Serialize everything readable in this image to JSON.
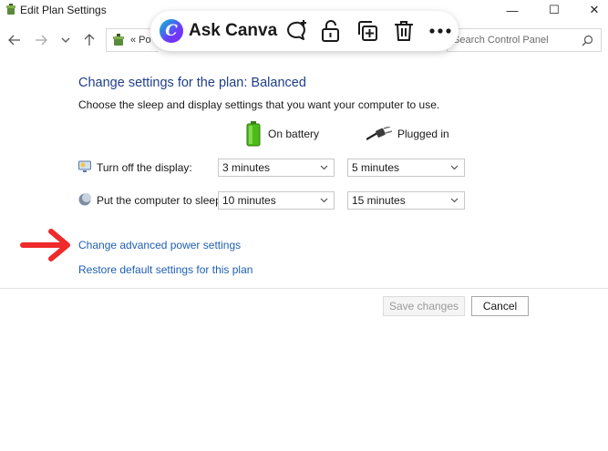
{
  "window": {
    "title": "Edit Plan Settings",
    "minimize_glyph": "—",
    "maximize_glyph": "☐",
    "close_glyph": "✕"
  },
  "navbar": {
    "address_text": "« Po",
    "search_placeholder": "Search Control Panel"
  },
  "canva_toolbar": {
    "logo_letter": "C",
    "label": "Ask Canva",
    "tools": [
      "comment-add-icon",
      "unlock-icon",
      "duplicate-icon",
      "trash-icon",
      "more-icon"
    ]
  },
  "plan": {
    "heading": "Change settings for the plan: Balanced",
    "subtitle": "Choose the sleep and display settings that you want your computer to use.",
    "columns": {
      "battery": "On battery",
      "plugged": "Plugged in"
    },
    "rows": [
      {
        "label": "Turn off the display:",
        "battery_value": "3 minutes",
        "plugged_value": "5 minutes"
      },
      {
        "label": "Put the computer to sleep:",
        "battery_value": "10 minutes",
        "plugged_value": "15 minutes"
      }
    ],
    "links": {
      "advanced": "Change advanced power settings",
      "restore": "Restore default settings for this plan"
    }
  },
  "buttons": {
    "save": "Save changes",
    "cancel": "Cancel"
  },
  "colors": {
    "heading": "#1f3f8a",
    "link": "#1f5fb4",
    "annotation_arrow": "#ee2a2a",
    "battery_green": "#4cbb17"
  }
}
